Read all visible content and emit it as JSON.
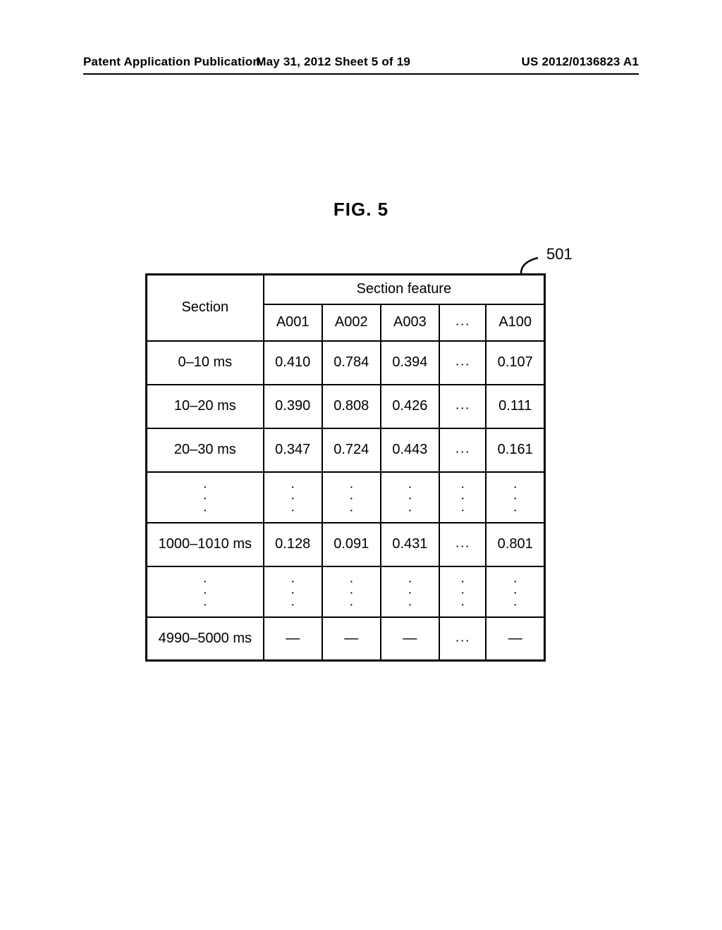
{
  "header": {
    "left": "Patent Application Publication",
    "center": "May 31, 2012  Sheet 5 of 19",
    "right": "US 2012/0136823 A1"
  },
  "figure_label": "FIG. 5",
  "callout": "501",
  "chart_data": {
    "type": "table",
    "title": "",
    "row_header": "Section",
    "col_group_header": "Section feature",
    "columns": [
      "A001",
      "A002",
      "A003",
      "…",
      "A100"
    ],
    "rows": [
      {
        "section": "0–10 ms",
        "values": [
          "0.410",
          "0.784",
          "0.394",
          "…",
          "0.107"
        ]
      },
      {
        "section": "10–20 ms",
        "values": [
          "0.390",
          "0.808",
          "0.426",
          "…",
          "0.111"
        ]
      },
      {
        "section": "20–30 ms",
        "values": [
          "0.347",
          "0.724",
          "0.443",
          "…",
          "0.161"
        ]
      },
      {
        "section": "⋮",
        "values": [
          "⋮",
          "⋮",
          "⋮",
          "⋮",
          "⋮"
        ]
      },
      {
        "section": "1000–1010 ms",
        "values": [
          "0.128",
          "0.091",
          "0.431",
          "…",
          "0.801"
        ]
      },
      {
        "section": "⋮",
        "values": [
          "⋮",
          "⋮",
          "⋮",
          "⋮",
          "⋮"
        ]
      },
      {
        "section": "4990–5000 ms",
        "values": [
          "—",
          "—",
          "—",
          "…",
          "—"
        ]
      }
    ]
  }
}
